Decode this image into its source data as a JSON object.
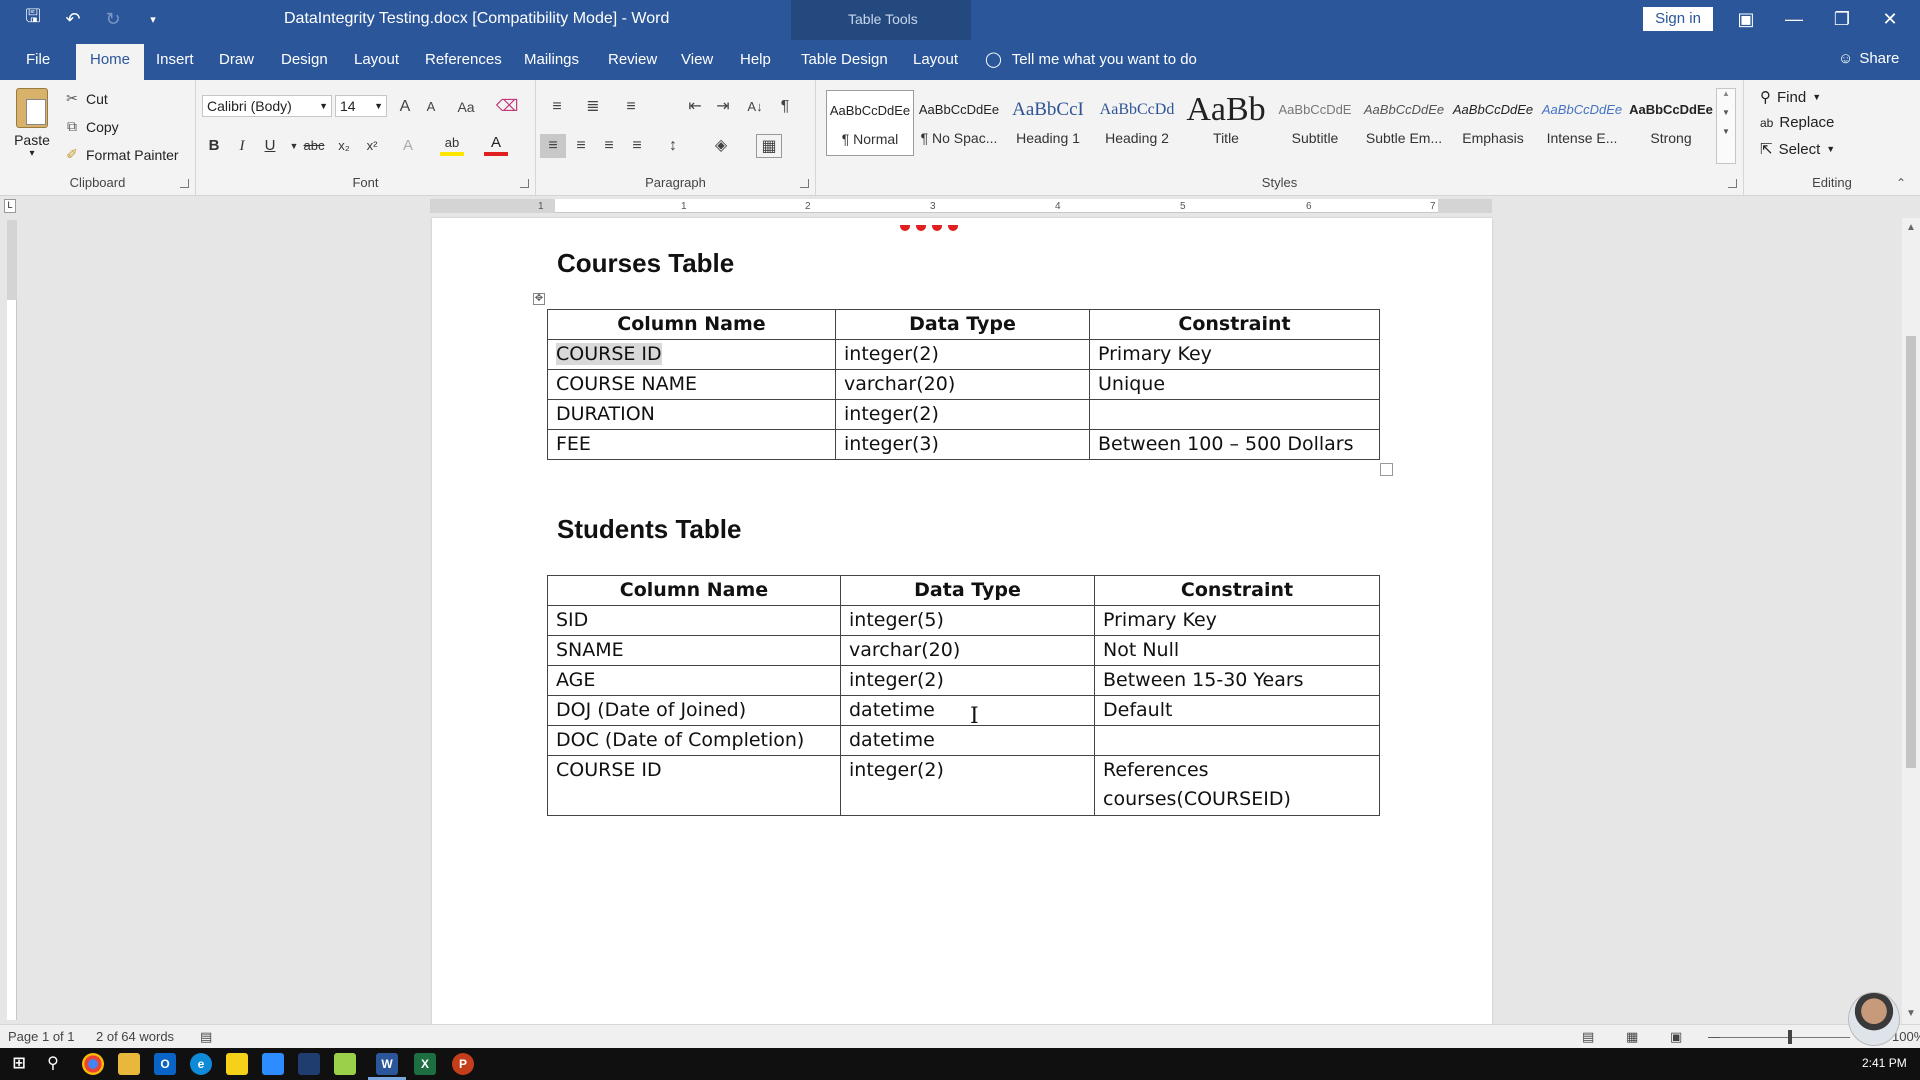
{
  "window": {
    "title": "DataIntegrity Testing.docx [Compatibility Mode] - Word",
    "context_group": "Table Tools",
    "sign_in": "Sign in"
  },
  "tabs": [
    {
      "label": "File"
    },
    {
      "label": "Home"
    },
    {
      "label": "Insert"
    },
    {
      "label": "Draw"
    },
    {
      "label": "Design"
    },
    {
      "label": "Layout"
    },
    {
      "label": "References"
    },
    {
      "label": "Mailings"
    },
    {
      "label": "Review"
    },
    {
      "label": "View"
    },
    {
      "label": "Help"
    },
    {
      "label": "Table Design"
    },
    {
      "label": "Layout"
    }
  ],
  "tell_me": "Tell me what you want to do",
  "share": "Share",
  "clipboard": {
    "paste": "Paste",
    "cut": "Cut",
    "copy": "Copy",
    "format_painter": "Format Painter",
    "label": "Clipboard"
  },
  "font": {
    "name": "Calibri (Body)",
    "size": "14",
    "label": "Font",
    "bold": "B",
    "italic": "I",
    "underline": "U",
    "strike": "abc",
    "sub": "x₂",
    "sup": "x²",
    "grow": "A",
    "shrink": "A",
    "case": "Aa"
  },
  "paragraph": {
    "label": "Paragraph"
  },
  "styles": {
    "label": "Styles",
    "items": [
      {
        "sample": "AaBbCcDdEe",
        "name": "¶ Normal"
      },
      {
        "sample": "AaBbCcDdEe",
        "name": "¶ No Spac..."
      },
      {
        "sample": "AaBbCcI",
        "name": "Heading 1"
      },
      {
        "sample": "AaBbCcDd",
        "name": "Heading 2"
      },
      {
        "sample": "AaBb",
        "name": "Title"
      },
      {
        "sample": "AaBbCcDdE",
        "name": "Subtitle"
      },
      {
        "sample": "AaBbCcDdEe",
        "name": "Subtle Em..."
      },
      {
        "sample": "AaBbCcDdEe",
        "name": "Emphasis"
      },
      {
        "sample": "AaBbCcDdEe",
        "name": "Intense E..."
      },
      {
        "sample": "AaBbCcDdEe",
        "name": "Strong"
      }
    ]
  },
  "editing": {
    "find": "Find",
    "replace": "Replace",
    "select": "Select",
    "label": "Editing"
  },
  "ruler_ticks": [
    "1",
    "1",
    "2",
    "3",
    "4",
    "5",
    "6",
    "7"
  ],
  "document": {
    "courses_heading": "Courses Table",
    "courses_table": {
      "headers": [
        "Column Name",
        "Data Type",
        "Constraint"
      ],
      "rows": [
        [
          "COURSE ID",
          "integer(2)",
          "Primary Key"
        ],
        [
          "COURSE NAME",
          "varchar(20)",
          "Unique"
        ],
        [
          "DURATION",
          "integer(2)",
          ""
        ],
        [
          "FEE",
          "integer(3)",
          "Between 100 – 500 Dollars"
        ]
      ]
    },
    "students_heading": "Students Table",
    "students_table": {
      "headers": [
        "Column Name",
        "Data Type",
        "Constraint"
      ],
      "rows": [
        [
          "SID",
          "integer(5)",
          "Primary Key"
        ],
        [
          "SNAME",
          "varchar(20)",
          "Not Null"
        ],
        [
          "AGE",
          "integer(2)",
          "Between 15-30 Years"
        ],
        [
          "DOJ (Date of Joined)",
          "datetime",
          "Default"
        ],
        [
          "DOC (Date of Completion)",
          "datetime",
          ""
        ],
        [
          "COURSE ID",
          "integer(2)",
          "References courses(COURSEID)"
        ]
      ]
    }
  },
  "status": {
    "page": "Page 1 of 1",
    "words": "2 of 64 words",
    "zoom": "100%"
  },
  "taskbar": {
    "time": "2:41 PM"
  },
  "colors": {
    "titlebar": "#2b579a",
    "ribbon": "#f3f3f3",
    "font_color_red": "#e02020",
    "highlight_yellow": "#ffe600"
  }
}
